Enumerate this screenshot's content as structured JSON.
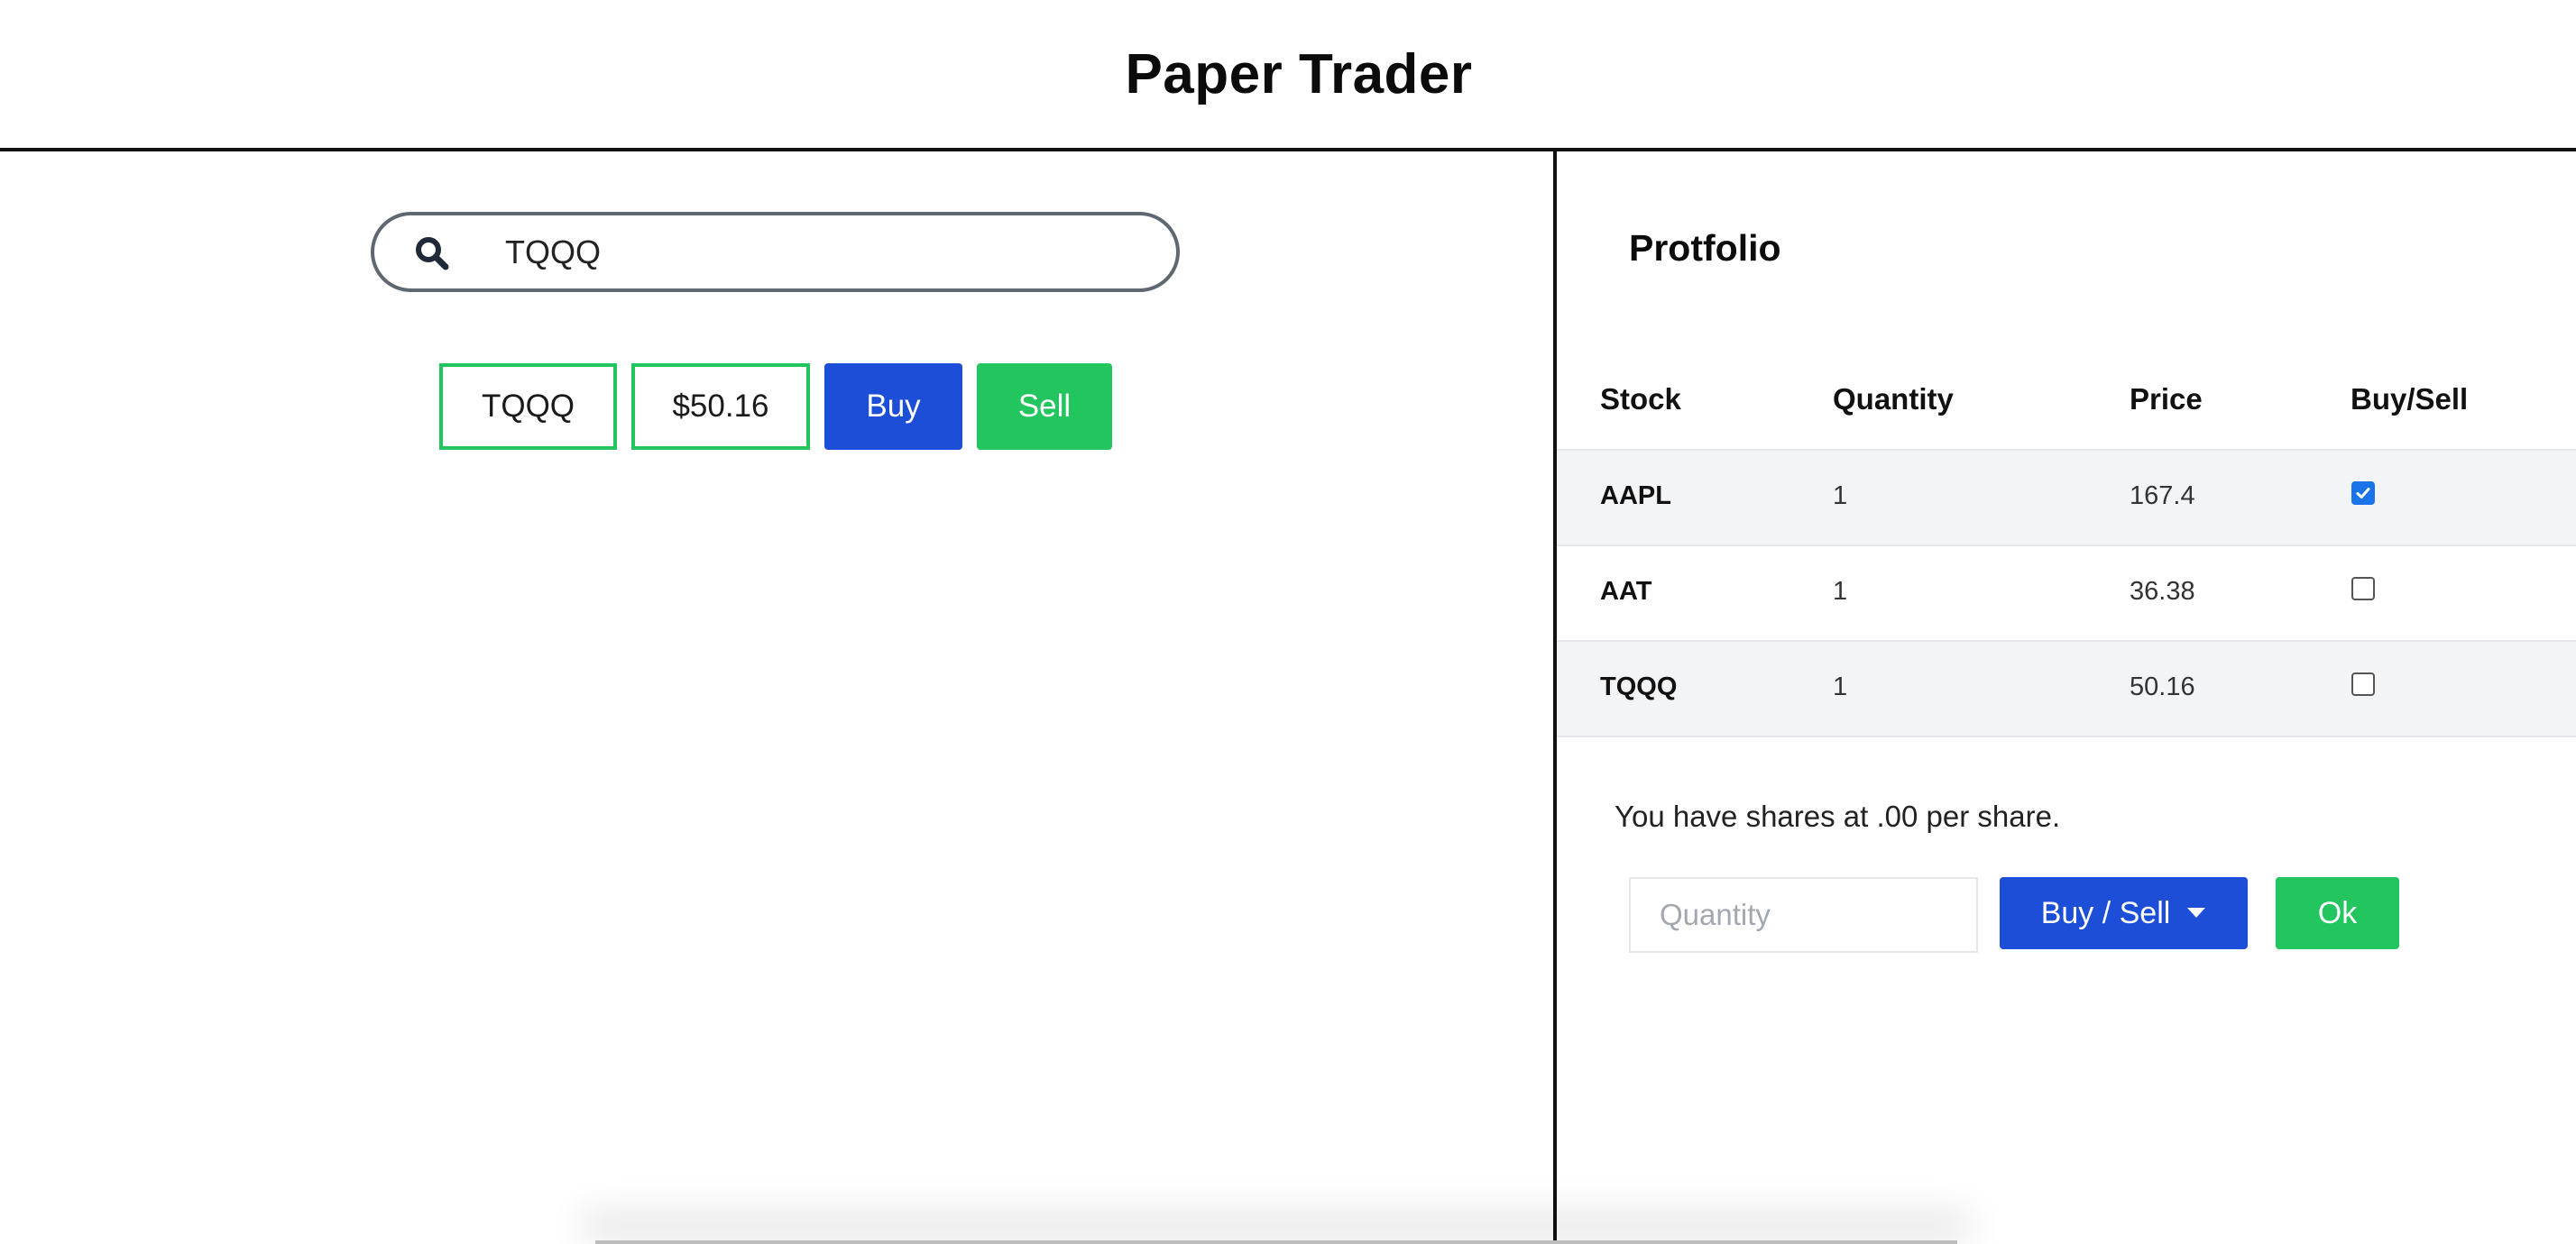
{
  "app": {
    "title": "Paper Trader"
  },
  "search": {
    "value": "TQQQ",
    "icon": "search-icon"
  },
  "quote": {
    "ticker": "TQQQ",
    "price": "$50.16",
    "buy_label": "Buy",
    "sell_label": "Sell"
  },
  "portfolio": {
    "title": "Protfolio",
    "columns": [
      "Stock",
      "Quantity",
      "Price",
      "Buy/Sell"
    ],
    "rows": [
      {
        "stock": "AAPL",
        "quantity": "1",
        "price": "167.4",
        "selected": true
      },
      {
        "stock": "AAT",
        "quantity": "1",
        "price": "36.38",
        "selected": false
      },
      {
        "stock": "TQQQ",
        "quantity": "1",
        "price": "50.16",
        "selected": false
      }
    ],
    "shares_message": "You have shares at .00 per share.",
    "quantity_placeholder": "Quantity",
    "buysell_label": "Buy / Sell",
    "ok_label": "Ok"
  },
  "colors": {
    "buy_blue": "#1d4ed8",
    "sell_green": "#22c55e",
    "row_alt": "#f3f4f6",
    "checkbox_checked": "#1a73e8"
  }
}
